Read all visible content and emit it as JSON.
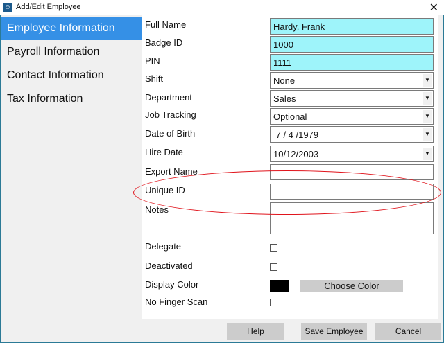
{
  "window": {
    "title": "Add/Edit Employee",
    "close": "✕"
  },
  "sidebar": {
    "items": [
      {
        "label": "Employee Information"
      },
      {
        "label": "Payroll Information"
      },
      {
        "label": "Contact Information"
      },
      {
        "label": "Tax Information"
      }
    ]
  },
  "form": {
    "full_name": {
      "label": "Full Name",
      "value": "Hardy, Frank"
    },
    "badge_id": {
      "label": "Badge ID",
      "value": "1000"
    },
    "pin": {
      "label": "PIN",
      "value": "1111"
    },
    "shift": {
      "label": "Shift",
      "value": "None"
    },
    "department": {
      "label": "Department",
      "value": "Sales"
    },
    "job_tracking": {
      "label": "Job Tracking",
      "value": "Optional"
    },
    "dob": {
      "label": "Date of Birth",
      "value": " 7 / 4 /1979"
    },
    "hire_date": {
      "label": "Hire Date",
      "value": "10/12/2003"
    },
    "export_name": {
      "label": "Export Name",
      "value": ""
    },
    "unique_id": {
      "label": "Unique ID",
      "value": ""
    },
    "notes": {
      "label": "Notes",
      "value": ""
    },
    "delegate": {
      "label": "Delegate",
      "checked": false
    },
    "deactivated": {
      "label": "Deactivated",
      "checked": false
    },
    "display_color": {
      "label": "Display Color",
      "color": "#000000",
      "button": "Choose Color"
    },
    "no_finger_scan": {
      "label": "No Finger Scan",
      "checked": false
    }
  },
  "footer": {
    "help": "Help",
    "save": "Save Employee",
    "cancel": "Cancel"
  }
}
